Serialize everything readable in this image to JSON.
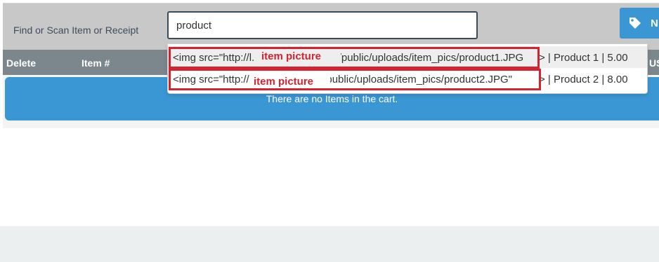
{
  "search": {
    "label": "Find or Scan Item or Receipt",
    "value": "product"
  },
  "toolbar": {
    "new_item_label": "N",
    "new_item_icon": "tag-icon"
  },
  "table": {
    "columns": [
      "Delete",
      "Item #",
      "USD"
    ],
    "empty_message": "There are no Items in the cart."
  },
  "autocomplete": {
    "items": [
      {
        "img_tag": "<img src=\"http://l.",
        "img_path": "s/public/uploads/item_pics/product1.JPG",
        "suffix": "> | Product 1 | 5.00"
      },
      {
        "img_tag": "<img src=\"http://",
        "img_path": "s/public/uploads/item_pics/product2.JPG\"",
        "suffix": "> | Product 2 | 8.00"
      }
    ]
  },
  "annotations": {
    "label_1": "item picture",
    "label_2": "item picture",
    "color": "#d52231"
  },
  "colors": {
    "accent": "#3a97d4",
    "header": "#7b868d",
    "search_bar": "#c8c8c8"
  }
}
